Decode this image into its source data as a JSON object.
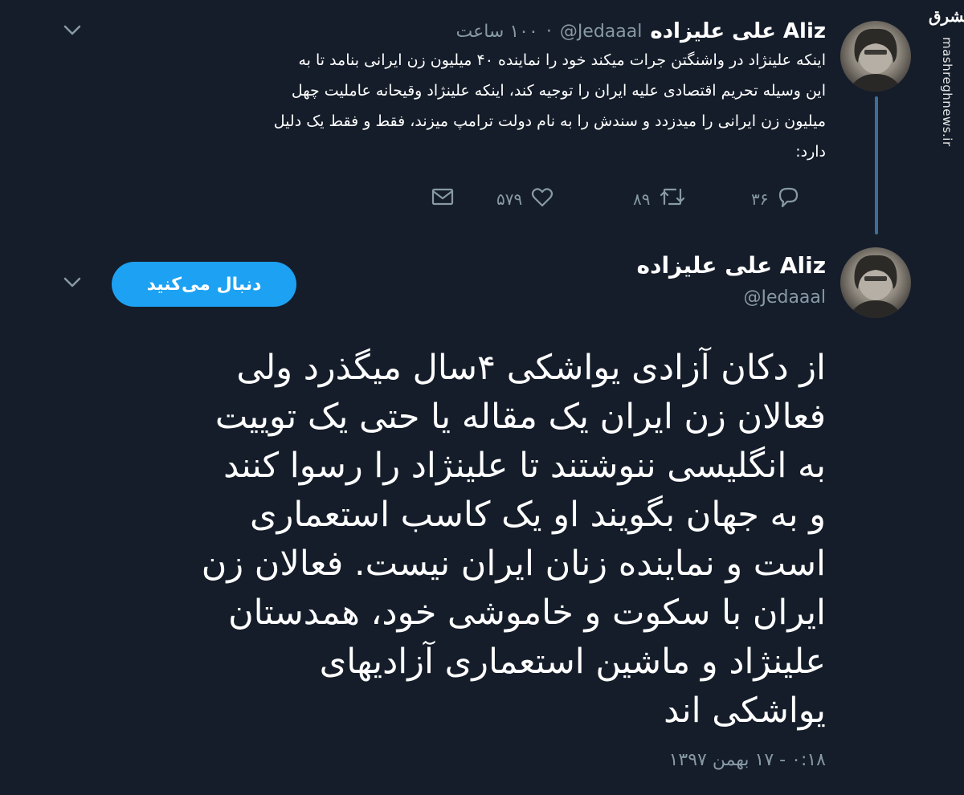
{
  "watermark": {
    "logo_text": "مشرق",
    "site": "mashreghnews.ir"
  },
  "tweet_top": {
    "name": "Aliz علی علیزاده",
    "handle": "@Jedaaal",
    "time": "۱۰۰ ساعت",
    "text_lines": [
      "اینکه علینژاد در واشنگتن جرات میکند خود را نماینده ۴۰ میلیون زن ایرانی بنامد تا به",
      "این وسیله تحریم اقتصادی علیه ایران را توجیه کند، اینکه علینژاد وقیحانه عاملیت چهل",
      "میلیون زن ایرانی را میدزدد و سندش را به نام دولت ترامپ میزند، فقط و فقط یک دلیل",
      "دارد:"
    ],
    "actions": {
      "replies": "۳۶",
      "retweets": "۸۹",
      "likes": "۵۷۹"
    }
  },
  "tweet_main": {
    "name": "Aliz علی علیزاده",
    "handle": "@Jedaaal",
    "follow_label": "دنبال می‌کنید",
    "text_lines": [
      "از دکان آزادی یواشکی ۴سال میگذرد ولی",
      "فعالان زن ایران یک مقاله یا حتی یک توییت",
      "به انگلیسی ننوشتند تا علینژاد را رسوا کنند",
      "و به جهان بگویند او یک کاسب استعماری",
      "است و نماینده زنان ایران نیست.  فعالان زن",
      "ایران با سکوت و خاموشی خود، همدستان",
      "علینژاد و ماشین استعماری آزادیهای",
      "یواشکی اند"
    ],
    "timestamp": "۰:۱۸ - ۱۷ بهمن ۱۳۹۷"
  },
  "icons": {
    "chevron": "chevron-down-icon",
    "reply": "reply-icon",
    "retweet": "retweet-icon",
    "like": "heart-icon",
    "dm": "envelope-icon"
  },
  "colors": {
    "background": "#151d2a",
    "accent": "#1da1f2",
    "muted": "#8899a6",
    "thread": "#3d6f96"
  }
}
